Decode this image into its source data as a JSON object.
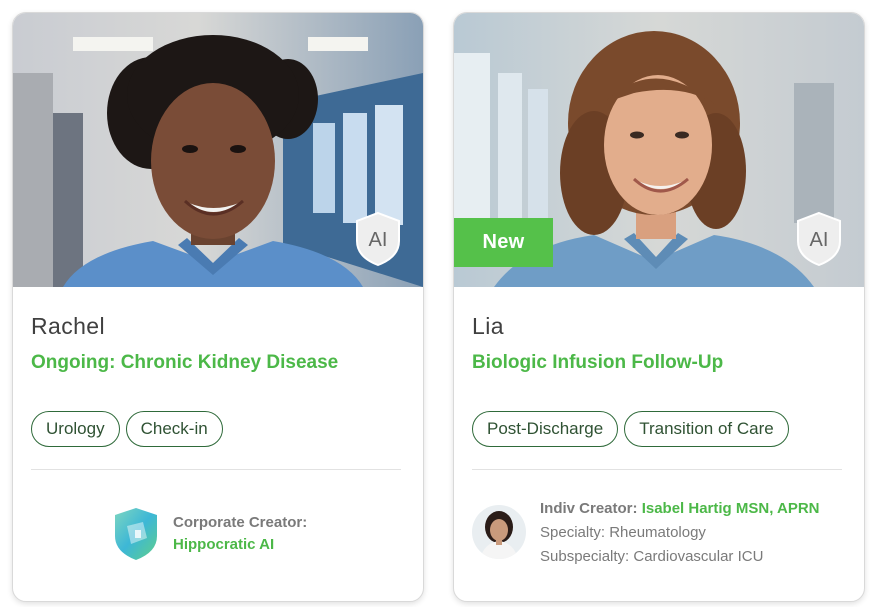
{
  "cards": [
    {
      "name": "Rachel",
      "title": "Ongoing: Chronic Kidney Disease",
      "tags": [
        "Urology",
        "Check-in"
      ],
      "ai_badge": "AI",
      "creator": {
        "label": "Corporate Creator:",
        "name": "Hippocratic AI",
        "logo_icon": "hippocratic-ai-shield-logo"
      }
    },
    {
      "name": "Lia",
      "title": "Biologic Infusion Follow-Up",
      "tags": [
        "Post-Discharge",
        "Transition of Care"
      ],
      "ai_badge": "AI",
      "new_badge": "New",
      "creator": {
        "label": "Indiv Creator:",
        "name": "Isabel Hartig MSN, APRN",
        "specialty": "Specialty: Rheumatology",
        "subspecialty": "Subspecialty: Cardiovascular ICU"
      }
    }
  ],
  "colors": {
    "accent_green": "#4cb848",
    "new_badge_bg": "#55c14a",
    "tag_border": "#2f6a3a",
    "scrub_blue": "#5b8fc9"
  }
}
